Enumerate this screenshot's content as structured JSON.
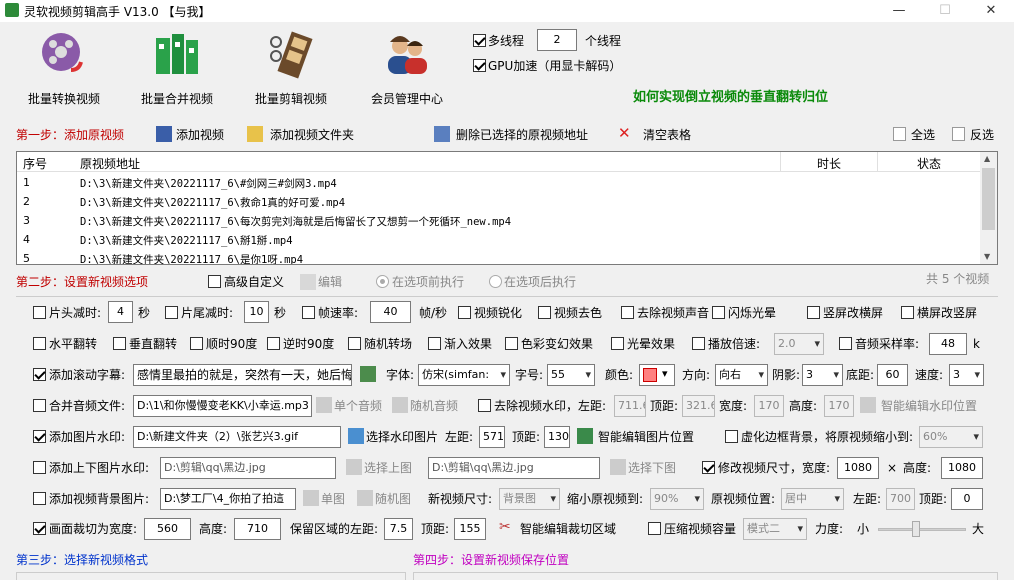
{
  "window": {
    "title": "灵软视频剪辑高手 V13.0 【与我】",
    "min": "—",
    "max": "☐",
    "close": "✕"
  },
  "toolbar": {
    "batch_convert": "批量转换视频",
    "batch_merge": "批量合并视频",
    "batch_edit": "批量剪辑视频",
    "member_center": "会员管理中心",
    "multithread_label": "多线程",
    "thread_count": "2",
    "thread_unit": "个线程",
    "gpu_label": "GPU加速（用显卡解码）",
    "tip_link": "如何实现倒立视频的垂直翻转归位"
  },
  "step1": {
    "title": "第一步：添加原视频",
    "add_video": "添加视频",
    "add_folder": "添加视频文件夹",
    "delete_selected": "删除已选择的原视频地址",
    "clear_table": "清空表格",
    "select_all": "全选",
    "invert": "反选"
  },
  "table": {
    "headers": [
      "序号",
      "原视频地址",
      "时长",
      "状态"
    ],
    "rows": [
      {
        "n": "1",
        "path": "D:\\3\\新建文件夹\\20221117_6\\#剑网三#剑网3.mp4"
      },
      {
        "n": "2",
        "path": "D:\\3\\新建文件夹\\20221117_6\\救命1真的好可爱.mp4"
      },
      {
        "n": "3",
        "path": "D:\\3\\新建文件夹\\20221117_6\\每次剪完刘海就是后悔留长了又想剪一个死循环_new.mp4"
      },
      {
        "n": "4",
        "path": "D:\\3\\新建文件夹\\20221117_6\\掰1掰.mp4"
      },
      {
        "n": "5",
        "path": "D:\\3\\新建文件夹\\20221117_6\\是你1呀.mp4"
      }
    ]
  },
  "step2": {
    "title": "第二步：设置新视频选项",
    "advanced": "高级自定义",
    "edit": "编辑",
    "before": "在选项前执行",
    "after": "在选项后执行",
    "count": "共 5 个视频"
  },
  "opts": {
    "head_cut": "片头减时:",
    "head_val": "4",
    "sec1": "秒",
    "tail_cut": "片尾减时:",
    "tail_val": "10",
    "sec2": "秒",
    "fps_label": "帧速率:",
    "fps_val": "40",
    "fps_unit": "帧/秒",
    "sharpen": "视频锐化",
    "decolor": "视频去色",
    "remove_audio": "去除视频声音",
    "flash": "闪烁光晕",
    "v2h": "竖屏改横屏",
    "h2v": "横屏改竖屏",
    "hflip": "水平翻转",
    "vflip": "垂直翻转",
    "cw90": "顺时90度",
    "ccw90": "逆时90度",
    "random_trans": "随机转场",
    "fade_in": "渐入效果",
    "color_change": "色彩变幻效果",
    "light": "光晕效果",
    "speed_label": "播放倍速:",
    "speed_val": "2.0",
    "sample_label": "音频采样率:",
    "sample_val": "48",
    "sample_unit": "k",
    "scroll_sub": "添加滚动字幕:",
    "scroll_text": "感情里最拍的就是，突然有一天，她后悔",
    "font_label": "字体:",
    "font_val": "仿宋(simfan:",
    "size_label": "字号:",
    "size_val": "55",
    "color_label": "颜色:",
    "dir_label": "方向:",
    "dir_val": "向右",
    "shadow_label": "阴影:",
    "shadow_val": "3",
    "bottom_label": "底距:",
    "bottom_val": "60",
    "speed2_label": "速度:",
    "speed2_val": "3",
    "merge_audio": "合并音频文件:",
    "merge_audio_path": "D:\\1\\和你慢慢变老KK\\小幸运.mp3",
    "single_audio": "单个音频",
    "random_audio": "随机音频",
    "remove_wm": "去除视频水印，左距:",
    "wm_left": "711.6",
    "wm_top_label": "顶距:",
    "wm_top": "321.6",
    "wm_w_label": "宽度:",
    "wm_w": "170",
    "wm_h_label": "高度:",
    "wm_h": "170",
    "smart_wm": "智能编辑水印位置",
    "img_wm": "添加图片水印:",
    "img_wm_path": "D:\\新建文件夹（2）\\张艺兴3.gif",
    "choose_wm": "选择水印图片",
    "img_left_label": "左距:",
    "img_left": "571",
    "img_top_label": "顶距:",
    "img_top": "130",
    "smart_img": "智能编辑图片位置",
    "blur_bg": "虚化边框背景，将原视频缩小到:",
    "blur_val": "60%",
    "topbottom": "添加上下图片水印:",
    "top_img": "D:\\剪辑\\qq\\黑边.jpg",
    "choose_top": "选择上图",
    "bottom_img": "D:\\剪辑\\qq\\黑边.jpg",
    "choose_bottom": "选择下图",
    "resize": "修改视频尺寸，宽度:",
    "resize_w": "1080",
    "times": "×",
    "resize_h_label": "高度:",
    "resize_h": "1080",
    "bg_img": "添加视频背景图片:",
    "bg_path": "D:\\梦工厂\\4_你拍了拍這",
    "single_img": "单图",
    "random_img": "随机图",
    "new_size_label": "新视频尺寸:",
    "new_size_val": "背景图",
    "shrink_label": "缩小原视频到:",
    "shrink_val": "90%",
    "pos_label": "原视频位置:",
    "pos_val": "居中",
    "bg_left_label": "左距:",
    "bg_left": "700",
    "bg_top_label": "顶距:",
    "bg_top": "0",
    "crop": "画面裁切为宽度:",
    "crop_w": "560",
    "crop_h_label": "高度:",
    "crop_h": "710",
    "keep_left_label": "保留区域的左距:",
    "keep_left": "7.5",
    "keep_top_label": "顶距:",
    "keep_top": "155",
    "smart_crop": "智能编辑裁切区域",
    "compress": "压缩视频容量",
    "mode_val": "模式二",
    "strength": "力度:",
    "small": "小",
    "big": "大"
  },
  "step3": {
    "title": "第三步：选择新视频格式"
  },
  "step4": {
    "title": "第四步：设置新视频保存位置"
  }
}
